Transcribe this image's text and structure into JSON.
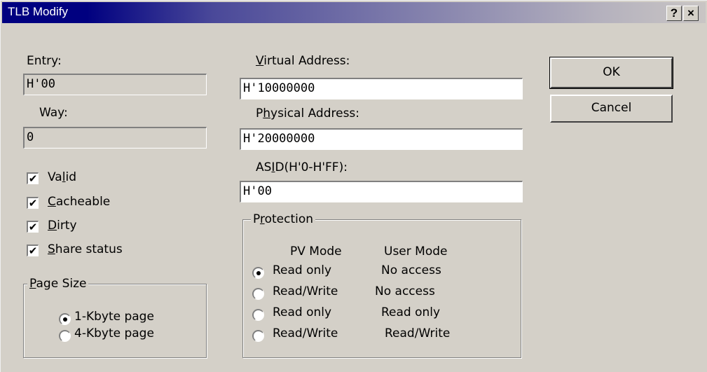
{
  "window": {
    "title": "TLB Modify",
    "help_button": "?",
    "close_button": "×"
  },
  "entry": {
    "label": "Entry:",
    "value": "H'00"
  },
  "way": {
    "label": "Way:",
    "value": "0"
  },
  "checkboxes": [
    {
      "label_pre": "Va",
      "label_key": "l",
      "label_post": "id",
      "checked": true,
      "mark": "✔"
    },
    {
      "label_pre": "",
      "label_key": "C",
      "label_post": "acheable",
      "checked": true,
      "mark": "✔"
    },
    {
      "label_pre": "",
      "label_key": "D",
      "label_post": "irty",
      "checked": true,
      "mark": "✔"
    },
    {
      "label_pre": "",
      "label_key": "S",
      "label_post": "hare status",
      "checked": true,
      "mark": "✔"
    }
  ],
  "page_size": {
    "legend_key": "P",
    "legend_post": "age Size",
    "options": [
      "1-Kbyte page",
      "4-Kbyte page"
    ],
    "selected": 0
  },
  "virtual_address": {
    "label_key": "V",
    "label_post": "irtual Address:",
    "value": "H'10000000"
  },
  "physical_address": {
    "label_pre": "P",
    "label_key": "h",
    "label_post": "ysical Address:",
    "value": "H'20000000"
  },
  "asid": {
    "label_pre": "AS",
    "label_key": "I",
    "label_post": "D(H'0-H'FF):",
    "value": "H'00"
  },
  "protection": {
    "legend_pre": "P",
    "legend_key": "r",
    "legend_post": "otection",
    "col_pv": "PV Mode",
    "col_user": "User Mode",
    "options": [
      {
        "pv": "Read only",
        "user": "No access"
      },
      {
        "pv": "Read/Write",
        "user": "No access"
      },
      {
        "pv": "Read only",
        "user": "Read only"
      },
      {
        "pv": "Read/Write",
        "user": "Read/Write"
      }
    ],
    "selected": 0
  },
  "buttons": {
    "ok": "OK",
    "cancel": "Cancel"
  }
}
